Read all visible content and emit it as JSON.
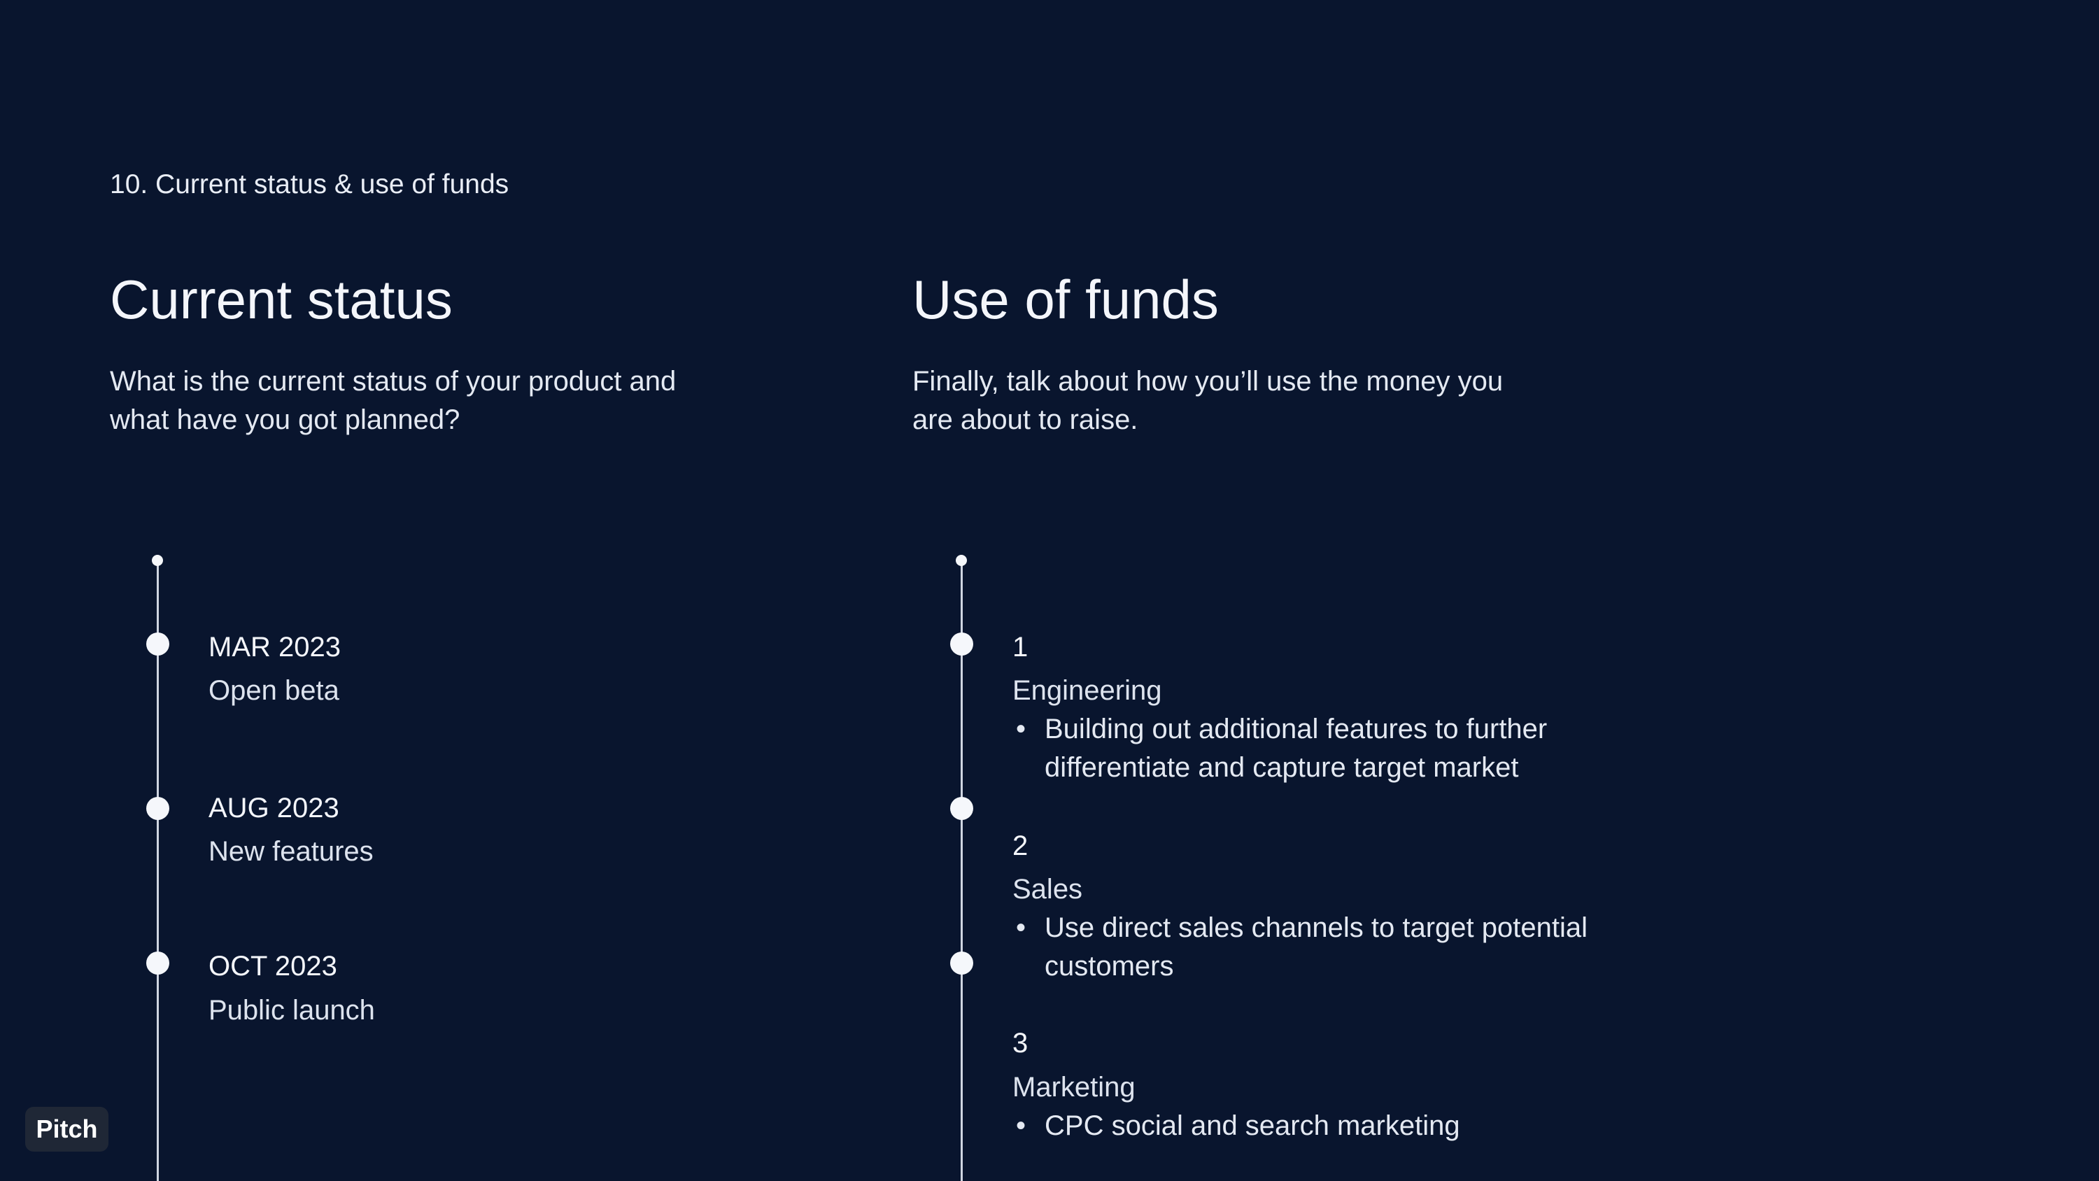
{
  "section_label": "10. Current status & use of funds",
  "current_status": {
    "heading": "Current status",
    "description": "What is the current status of your product and\nwhat have you got planned?",
    "milestones": [
      {
        "date": "MAR 2023",
        "title": "Open beta"
      },
      {
        "date": "AUG 2023",
        "title": "New features"
      },
      {
        "date": "OCT 2023",
        "title": "Public launch"
      }
    ]
  },
  "use_of_funds": {
    "heading": "Use of funds",
    "description": "Finally, talk about how you’ll use the money you\nare about to raise.",
    "bullet_symbol": "•",
    "items": [
      {
        "number": "1",
        "title": "Engineering",
        "bullet": "Building out additional features to further\ndifferentiate and capture target market"
      },
      {
        "number": "2",
        "title": "Sales",
        "bullet": "Use direct sales channels to target potential\ncustomers"
      },
      {
        "number": "3",
        "title": "Marketing",
        "bullet": "CPC social and search marketing"
      }
    ]
  },
  "badge": {
    "label": "Pitch"
  },
  "colors": {
    "background": "#09152e",
    "text": "#f1f4fa",
    "timeline": "#cfd5e1",
    "badge_bg": "#1f2736"
  }
}
